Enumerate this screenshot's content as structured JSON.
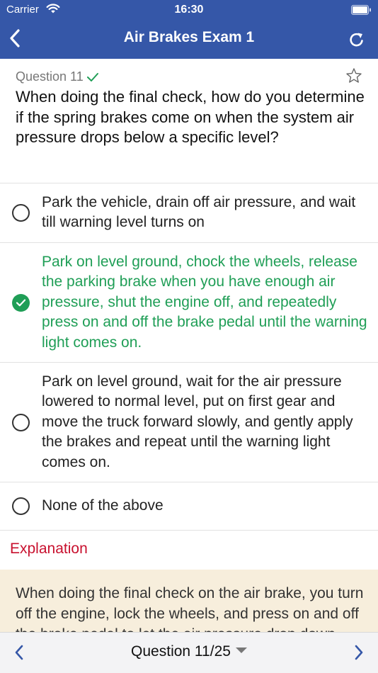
{
  "status_bar": {
    "carrier": "Carrier",
    "time": "16:30"
  },
  "nav": {
    "title": "Air Brakes Exam 1"
  },
  "question": {
    "number_label": "Question 11",
    "text": "When doing the final check, how do you determine if the spring brakes come on when the system air pressure drops below a specific level?"
  },
  "options": [
    {
      "text": "Park the vehicle, drain off air pressure, and wait till warning level turns on",
      "selected": false
    },
    {
      "text": "Park on level ground, chock the wheels, release the parking brake when you have enough air pressure, shut the engine off, and repeatedly press on and off the brake pedal until the warning light comes on.",
      "selected": true
    },
    {
      "text": "Park on level ground, wait for the air pressure lowered to normal level, put on first gear and move the truck forward slowly, and gently apply the brakes and repeat until the warning light comes on.",
      "selected": false
    },
    {
      "text": "None of the above",
      "selected": false
    }
  ],
  "explanation": {
    "title": "Explanation",
    "text": "When doing the final check on the air brake, you turn off the engine, lock the wheels, and press on and off the brake pedal to let the air pressure drop down."
  },
  "footer": {
    "progress_label": "Question 11/25"
  },
  "colors": {
    "header_bg": "#3557a8",
    "correct_green": "#1f9e56",
    "explanation_red": "#c8102e",
    "explanation_bg": "#f7eedc",
    "footer_accent": "#3557a8"
  },
  "icons": {
    "wifi": "wifi-icon",
    "battery": "battery-icon",
    "back": "chevron-left-icon",
    "refresh": "refresh-icon",
    "answered": "checkmark-icon",
    "bookmark": "star-icon",
    "prev": "chevron-left-icon",
    "next": "chevron-right-icon",
    "picker": "caret-down-icon"
  }
}
